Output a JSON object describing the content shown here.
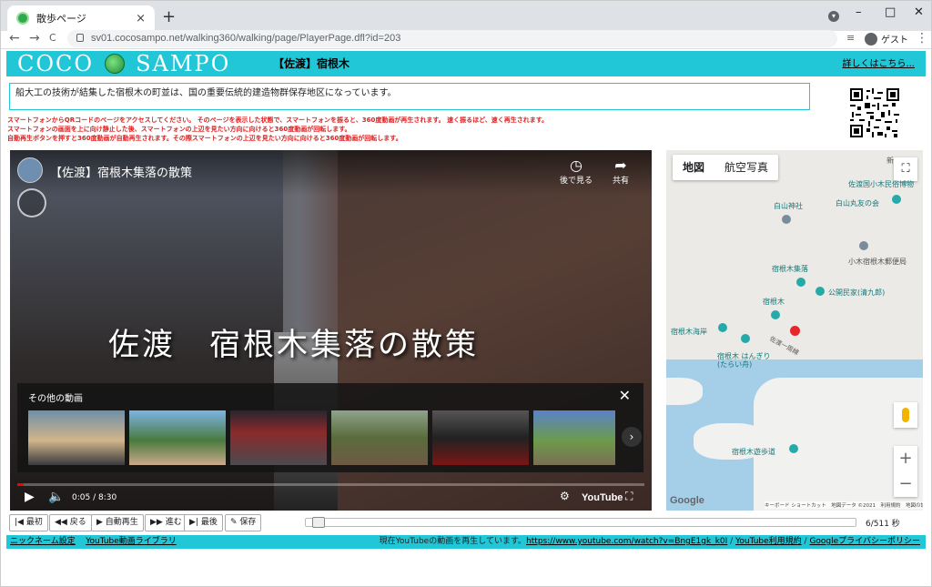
{
  "browser": {
    "tab_title": "散歩ページ",
    "tab_close": "×",
    "new_tab": "+",
    "url": "sv01.cocosampo.net/walking360/walking/page/PlayerPage.dfl?id=203",
    "profile": "ゲスト",
    "nav": {
      "back": "←",
      "forward": "→",
      "reload": "C"
    },
    "window": {
      "minimize": "–",
      "maximize": "□",
      "close": "✕"
    }
  },
  "header": {
    "logo_left": "COCO",
    "logo_right": "SAMPO",
    "place_title": "【佐渡】宿根木",
    "more_link": "詳しくはこちら..."
  },
  "description": "船大工の技術が結集した宿根木の町並は、国の重要伝統的建造物群保存地区になっています。",
  "notes": [
    "スマートフォンからQRコードのページをアクセスしてください。 そのページを表示した状態で、スマートフォンを振ると、360度動画が再生されます。 速く振るほど、速く再生されます。",
    "スマートフォンの画面を上に向け静止した後、スマートフォンの上辺を見たい方向に向けると360度動画が回転します。",
    "自動再生ボタンを押すと360度動画が自動再生されます。その際スマートフォンの上辺を見たい方向に向けると360度動画が回転します。"
  ],
  "video": {
    "title": "【佐渡】宿根木集落の散策",
    "watch_later": "後で見る",
    "share": "共有",
    "caption": "佐渡　宿根木集落の散策",
    "more_videos": "その他の動画",
    "time": "0:05 / 8:30",
    "progress": 0.01,
    "youtube": "YouTube"
  },
  "map": {
    "type_map": "地図",
    "type_satellite": "航空写真",
    "labels": [
      "白山神社",
      "佐渡国小木民俗博物",
      "白山丸友の会",
      "小木宿根木郵便局",
      "宿根木集落",
      "公開民家(清九郎)",
      "宿根木",
      "宿根木海岸",
      "宿根木 はんぎり (たらい舟)",
      "佐渡一周線",
      "宿根木遊歩道",
      "新"
    ],
    "zoom_in": "+",
    "zoom_out": "−",
    "google": "Google",
    "attribution": "キーボード ショートカット　地図データ ©2021　利用規約　地図の誤りを報告する"
  },
  "playbar": {
    "first": "最初",
    "back": "戻る",
    "auto": "自動再生",
    "forward": "進む",
    "last": "最後",
    "save": "保存",
    "counter": "6/511 秒",
    "position": 0.012
  },
  "footer": {
    "nickname": "ニックネーム設定",
    "library": "YouTube動画ライブラリ",
    "status": "現在YouTubeの動画を再生しています。",
    "video_url": "https://www.youtube.com/watch?v=BngE1gk_k0I",
    "tos": "YouTube利用規約",
    "privacy": "Googleプライバシーポリシー"
  },
  "colors": {
    "accent": "#21c6d7",
    "note_red": "#e02020",
    "red_pin": "#e8262a",
    "progress": "#ff0000"
  }
}
